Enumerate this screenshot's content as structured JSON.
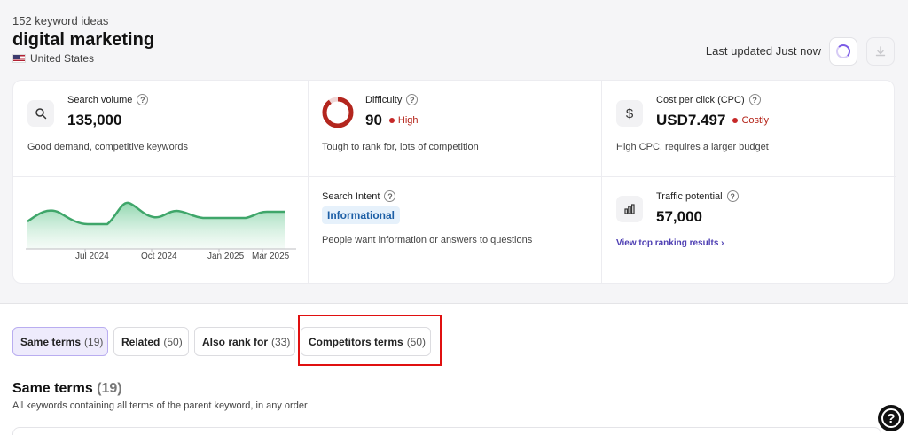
{
  "header": {
    "count": "152 keyword ideas",
    "keyword": "digital marketing",
    "country": "United States",
    "last_updated": "Last updated Just now"
  },
  "metrics": {
    "search_volume": {
      "label": "Search volume",
      "value": "135,000",
      "desc": "Good demand, competitive keywords",
      "icon": "search-icon"
    },
    "difficulty": {
      "label": "Difficulty",
      "value": "90",
      "badge": "High",
      "desc": "Tough to rank for, lots of competition",
      "level": 90
    },
    "cpc": {
      "label": "Cost per click (CPC)",
      "value": "USD7.497",
      "badge": "Costly",
      "desc": "High CPC, requires a larger budget",
      "icon": "dollar-icon"
    },
    "intent": {
      "label": "Search Intent",
      "value": "Informational",
      "desc": "People want information or answers to questions"
    },
    "traffic": {
      "label": "Traffic potential",
      "value": "57,000",
      "link": "View top ranking results ›",
      "icon": "bar-chart-icon"
    }
  },
  "chart_data": {
    "type": "area",
    "x_ticks": [
      "Jul 2024",
      "Oct 2024",
      "Jan 2025",
      "Mar 2025"
    ],
    "color": "#3fa66a"
  },
  "tabs": [
    {
      "label": "Same terms",
      "count": "(19)"
    },
    {
      "label": "Related",
      "count": "(50)"
    },
    {
      "label": "Also rank for",
      "count": "(33)"
    },
    {
      "label": "Competitors terms",
      "count": "(50)"
    }
  ],
  "section": {
    "title": "Same terms",
    "count": "(19)",
    "subtitle": "All keywords containing all terms of the parent keyword, in any order"
  },
  "help_label": "?"
}
